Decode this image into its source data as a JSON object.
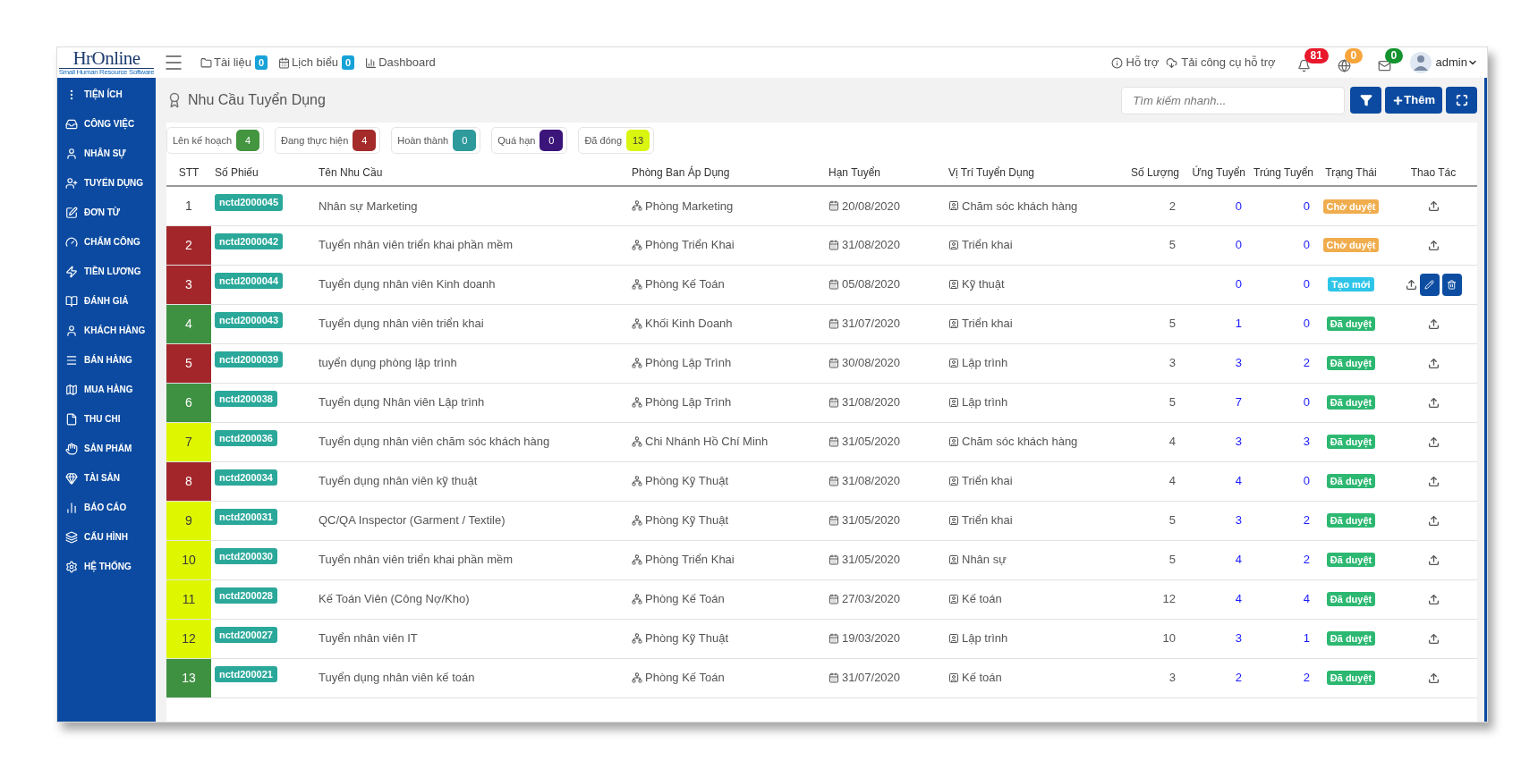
{
  "logo": {
    "name": "HrOnline",
    "tagline": "Small Human Resource Software"
  },
  "topbar": {
    "links": [
      {
        "label": "Tài liệu",
        "badge": "0"
      },
      {
        "label": "Lịch biểu",
        "badge": "0"
      },
      {
        "label": "Dashboard"
      }
    ],
    "right_links": [
      {
        "label": "Hỗ trợ"
      },
      {
        "label": "Tải công cụ hỗ trợ"
      }
    ],
    "notifications": [
      {
        "count": "81",
        "color": "#e8192c"
      },
      {
        "count": "0",
        "color": "#f6a53a"
      },
      {
        "count": "0",
        "color": "#14932f"
      }
    ],
    "user": "admin"
  },
  "sidebar": {
    "items": [
      {
        "label": "TIỆN ÍCH"
      },
      {
        "label": "CÔNG VIỆC"
      },
      {
        "label": "NHÂN SỰ"
      },
      {
        "label": "TUYỂN DỤNG"
      },
      {
        "label": "ĐƠN TỪ"
      },
      {
        "label": "CHẤM CÔNG"
      },
      {
        "label": "TIỀN LƯƠNG"
      },
      {
        "label": "ĐÁNH GIÁ"
      },
      {
        "label": "KHÁCH HÀNG"
      },
      {
        "label": "BÁN HÀNG"
      },
      {
        "label": "MUA HÀNG"
      },
      {
        "label": "THU CHI"
      },
      {
        "label": "SẢN PHẨM"
      },
      {
        "label": "TÀI SẢN"
      },
      {
        "label": "BÁO CÁO"
      },
      {
        "label": "CẤU HÌNH"
      },
      {
        "label": "HỆ THỐNG"
      }
    ]
  },
  "page": {
    "title": "Nhu Cầu Tuyển Dụng",
    "search": {
      "placeholder": "Tìm kiếm nhanh..."
    },
    "add_button": "Thêm"
  },
  "filters": [
    {
      "label": "Lên kế hoạch",
      "count": "4",
      "color": "#43953f"
    },
    {
      "label": "Đang thực hiện",
      "count": "4",
      "color": "#a52a2a"
    },
    {
      "label": "Hoàn thành",
      "count": "0",
      "color": "#2e9a9c"
    },
    {
      "label": "Quá hạn",
      "count": "0",
      "color": "#3b157a"
    },
    {
      "label": "Đã đóng",
      "count": "13",
      "color": "#daf50f"
    }
  ],
  "table": {
    "columns": [
      "STT",
      "Số Phiếu",
      "Tên Nhu Cầu",
      "Phòng Ban Áp Dụng",
      "Hạn Tuyển",
      "Vị Trí Tuyển Dụng",
      "Số Lượng",
      "Ứng Tuyển",
      "Trúng Tuyển",
      "Trạng Thái",
      "Thao Tác"
    ],
    "rows": [
      {
        "stt": "1",
        "code": "nctd2000045",
        "name": "Nhân sự Marketing",
        "dept": "Phòng Marketing",
        "deadline": "20/08/2020",
        "position": "Chăm sóc khách hàng",
        "qty": "2",
        "applied": "0",
        "hired": "0",
        "status": {
          "text": "Chờ duyệt",
          "kind": "pending"
        },
        "hovered": false
      },
      {
        "stt": "2",
        "code": "nctd2000042",
        "name": "Tuyển nhân viên triển khai phần mềm",
        "dept": "Phòng Triển Khai",
        "deadline": "31/08/2020",
        "position": "Triển khai",
        "qty": "5",
        "applied": "0",
        "hired": "0",
        "status": {
          "text": "Chờ duyệt",
          "kind": "pending"
        },
        "color": "#a3262a",
        "hovered": false
      },
      {
        "stt": "3",
        "code": "nctd2000044",
        "name": "Tuyển dụng nhân viên Kinh doanh",
        "dept": "Phòng Kế Toán",
        "deadline": "05/08/2020",
        "position": "Kỹ thuật",
        "applied": "0",
        "hired": "0",
        "status": {
          "text": "Tạo mới",
          "kind": "new"
        },
        "color": "#a3262a",
        "hovered": true
      },
      {
        "stt": "4",
        "code": "nctd2000043",
        "name": "Tuyển dụng nhân viên triển khai",
        "dept": "Khối Kinh Doanh",
        "deadline": "31/07/2020",
        "position": "Triển khai",
        "qty": "5",
        "applied": "1",
        "hired": "0",
        "status": {
          "text": "Đã duyệt",
          "kind": "approved"
        },
        "color": "#3f9142",
        "hovered": false
      },
      {
        "stt": "5",
        "code": "nctd2000039",
        "name": "tuyển dụng phòng lập trình",
        "dept": "Phòng Lập Trình",
        "deadline": "30/08/2020",
        "position": "Lập trình",
        "qty": "3",
        "applied": "3",
        "hired": "2",
        "status": {
          "text": "Đã duyệt",
          "kind": "approved"
        },
        "color": "#a3262a",
        "hovered": false
      },
      {
        "stt": "6",
        "code": "nctd200038",
        "name": "Tuyển dụng Nhân viên Lập trình",
        "dept": "Phòng Lập Trình",
        "deadline": "31/08/2020",
        "position": "Lập trình",
        "qty": "5",
        "applied": "7",
        "hired": "0",
        "status": {
          "text": "Đã duyệt",
          "kind": "approved"
        },
        "color": "#3f9142",
        "hovered": false
      },
      {
        "stt": "7",
        "code": "nctd200036",
        "name": "Tuyển dụng nhân viên chăm sóc khách hàng",
        "dept": "Chi Nhánh Hồ Chí Minh",
        "deadline": "31/05/2020",
        "position": "Chăm sóc khách hàng",
        "qty": "4",
        "applied": "3",
        "hired": "3",
        "status": {
          "text": "Đã duyệt",
          "kind": "approved"
        },
        "color": "#def700",
        "hovered": false
      },
      {
        "stt": "8",
        "code": "nctd200034",
        "name": "Tuyển dụng nhân viên kỹ thuật",
        "dept": "Phòng Kỹ Thuật",
        "deadline": "31/08/2020",
        "position": "Triển khai",
        "qty": "4",
        "applied": "4",
        "hired": "0",
        "status": {
          "text": "Đã duyệt",
          "kind": "approved"
        },
        "color": "#a3262a",
        "hovered": false
      },
      {
        "stt": "9",
        "code": "nctd200031",
        "name": "QC/QA Inspector (Garment / Textile)",
        "dept": "Phòng Kỹ Thuật",
        "deadline": "31/05/2020",
        "position": "Triển khai",
        "qty": "5",
        "applied": "3",
        "hired": "2",
        "status": {
          "text": "Đã duyệt",
          "kind": "approved"
        },
        "color": "#def700",
        "hovered": false
      },
      {
        "stt": "10",
        "code": "nctd200030",
        "name": "Tuyển nhân viên triển khai phần mềm",
        "dept": "Phòng Triển Khai",
        "deadline": "31/05/2020",
        "position": "Nhân sự",
        "qty": "5",
        "applied": "4",
        "hired": "2",
        "status": {
          "text": "Đã duyệt",
          "kind": "approved"
        },
        "color": "#def700",
        "hovered": false
      },
      {
        "stt": "11",
        "code": "nctd200028",
        "name": "Kế Toán Viên (Công Nợ/Kho)",
        "dept": "Phòng Kế Toán",
        "deadline": "27/03/2020",
        "position": "Kế toán",
        "qty": "12",
        "applied": "4",
        "hired": "4",
        "status": {
          "text": "Đã duyệt",
          "kind": "approved"
        },
        "color": "#def700",
        "hovered": false
      },
      {
        "stt": "12",
        "code": "nctd200027",
        "name": "Tuyển nhân viên IT",
        "dept": "Phòng Kỹ Thuật",
        "deadline": "19/03/2020",
        "position": "Lập trình",
        "qty": "10",
        "applied": "3",
        "hired": "1",
        "status": {
          "text": "Đã duyệt",
          "kind": "approved"
        },
        "color": "#def700",
        "hovered": false
      },
      {
        "stt": "13",
        "code": "nctd200021",
        "name": "Tuyển dụng nhân viên kế toán",
        "dept": "Phòng Kế Toán",
        "deadline": "31/07/2020",
        "position": "Kế toán",
        "qty": "3",
        "applied": "2",
        "hired": "2",
        "status": {
          "text": "Đã duyệt",
          "kind": "approved"
        },
        "color": "#3f9142",
        "hovered": false
      }
    ]
  }
}
